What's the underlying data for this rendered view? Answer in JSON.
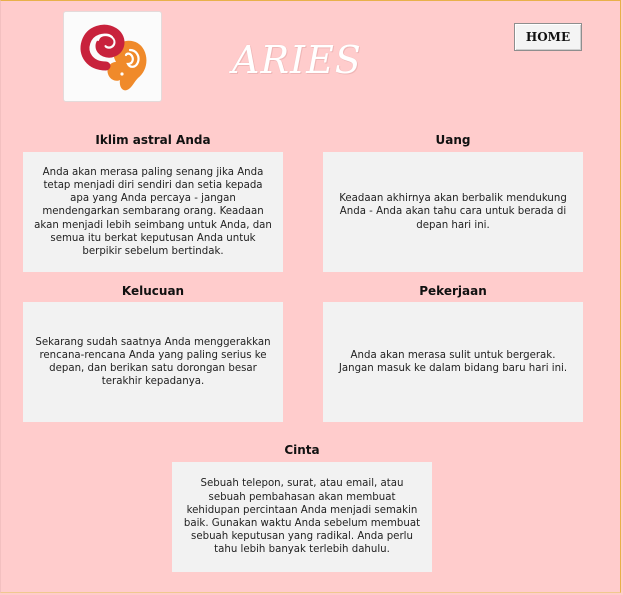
{
  "header": {
    "logo": {
      "icon": "aries-ram-icon"
    },
    "title": "ARIES",
    "home_label": "HOME"
  },
  "sections": [
    {
      "id": "iklim",
      "title": "Iklim astral Anda",
      "text": "Anda akan merasa paling senang jika Anda tetap menjadi diri sendiri dan setia kepada apa yang Anda percaya - jangan mendengarkan sembarang orang. Keadaan akan menjadi lebih seimbang untuk Anda, dan semua itu berkat keputusan Anda untuk berpikir sebelum bertindak."
    },
    {
      "id": "uang",
      "title": "Uang",
      "text": "Keadaan akhirnya akan berbalik mendukung Anda - Anda akan tahu cara untuk berada di depan hari ini."
    },
    {
      "id": "kelucuan",
      "title": "Kelucuan",
      "text": "Sekarang sudah saatnya Anda menggerakkan rencana-rencana Anda yang paling serius ke depan, dan berikan satu dorongan besar terakhir kepadanya."
    },
    {
      "id": "pekerjaan",
      "title": "Pekerjaan",
      "text": "Anda akan merasa sulit untuk bergerak. Jangan masuk ke dalam bidang baru hari ini."
    },
    {
      "id": "cinta",
      "title": "Cinta",
      "text": "Sebuah telepon, surat, atau email, atau sebuah pembahasan akan membuat kehidupan percintaan Anda menjadi semakin baik. Gunakan waktu Anda sebelum membuat sebuah keputusan yang radikal. Anda perlu tahu lebih banyak terlebih dahulu."
    }
  ],
  "colors": {
    "background": "#ffcccc",
    "card": "#f2f2f2",
    "logo_red": "#c8223c",
    "logo_orange": "#f08a2a"
  }
}
